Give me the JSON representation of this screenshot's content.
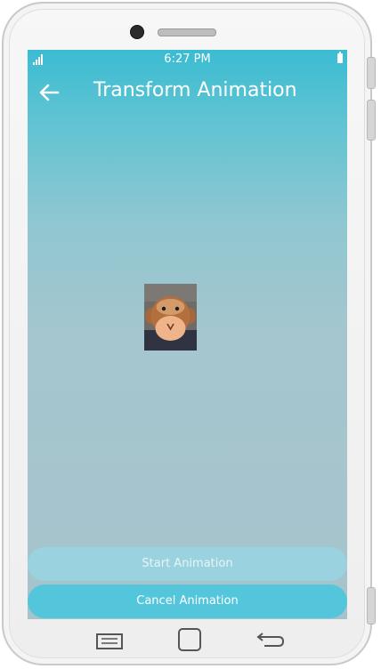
{
  "status_bar": {
    "time": "6:27 PM",
    "signal_icon": "signal-icon",
    "battery_icon": "battery-icon"
  },
  "app_bar": {
    "back_icon": "arrow-left-icon",
    "title": "Transform Animation"
  },
  "content": {
    "image_icon": "monkey-image"
  },
  "buttons": {
    "start_label": "Start Animation",
    "cancel_label": "Cancel Animation"
  },
  "colors": {
    "accent": "#3bbcd2",
    "start_button": "#9ad3df",
    "cancel_button": "#54c6dc"
  },
  "nav_keys": {
    "recent_icon": "recent-apps-icon",
    "home_icon": "home-icon",
    "back_icon": "back-key-icon"
  }
}
